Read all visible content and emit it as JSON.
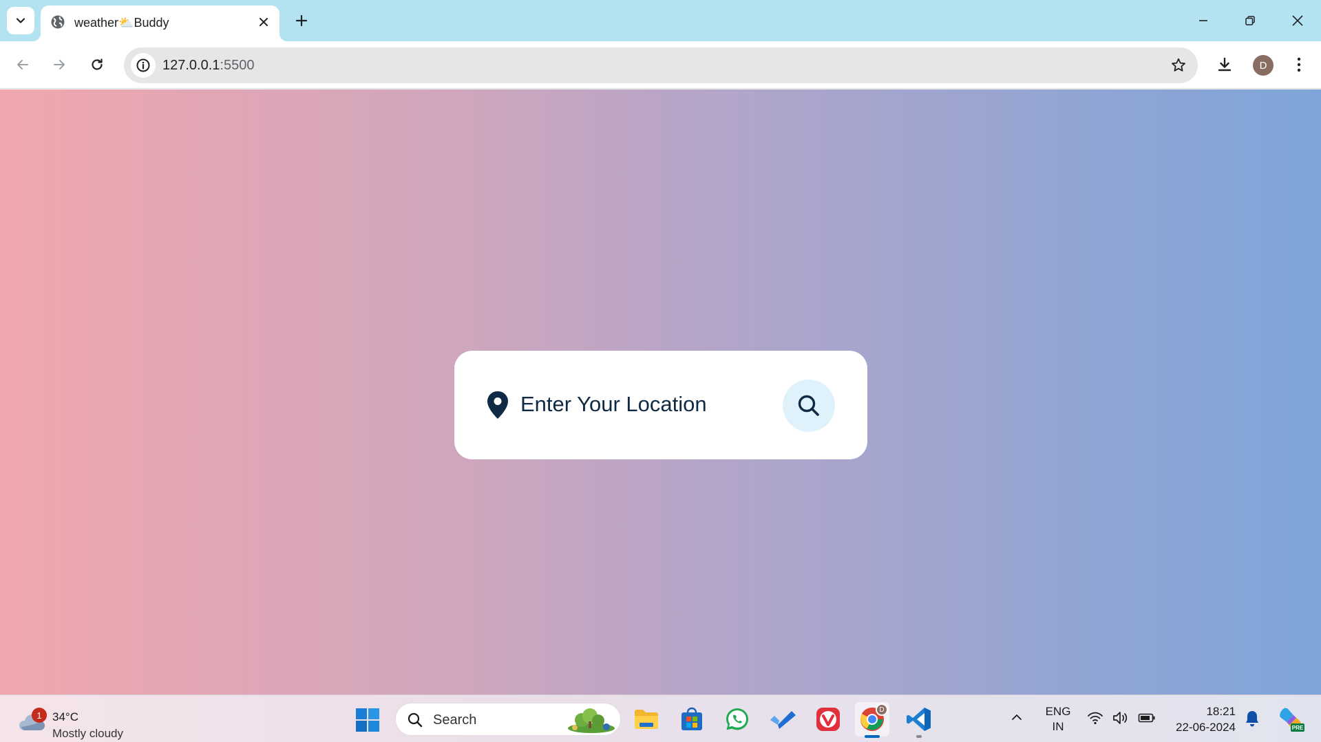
{
  "browser": {
    "tab": {
      "title": "weather⛅Buddy"
    },
    "url": {
      "host": "127.0.0.1",
      "port": ":5500"
    },
    "profile_initial": "D"
  },
  "page": {
    "search": {
      "placeholder": "Enter Your Location"
    }
  },
  "taskbar": {
    "weather": {
      "badge": "1",
      "temp": "34°C",
      "desc": "Mostly cloudy"
    },
    "search_placeholder": "Search",
    "chrome_badge": "D",
    "language": {
      "line1": "ENG",
      "line2": "IN"
    },
    "clock": {
      "time": "18:21",
      "date": "22-06-2024"
    }
  },
  "colors": {
    "gradient_left": "#f0a7ad",
    "gradient_right": "#7ea5d9",
    "tabstrip": "#b3e3f1",
    "search_button": "#dff1fb",
    "text_dark": "#0f2a44"
  }
}
